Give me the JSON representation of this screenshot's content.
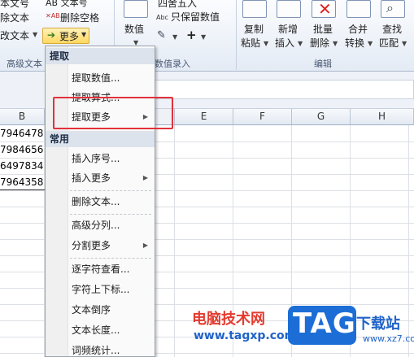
{
  "ribbon": {
    "left_items": [
      "本文号",
      "除文本",
      "改文本"
    ],
    "text_buttons": [
      "AB 文本号",
      "删除空格"
    ],
    "more_label": "更多",
    "group_label_left": "高级文本",
    "num_label": "数值",
    "num_items": [
      "四舍五入",
      "只保留数值"
    ],
    "num_group_label": "数值录入",
    "edit_buttons": [
      {
        "line1": "复制",
        "line2": "粘贴"
      },
      {
        "line1": "新增",
        "line2": "插入"
      },
      {
        "line1": "批量",
        "line2": "删除"
      },
      {
        "line1": "合并",
        "line2": "转换"
      },
      {
        "line1": "查找",
        "line2": "匹配"
      }
    ],
    "edit_group_label": "编辑"
  },
  "columns": [
    "B",
    "E",
    "F",
    "G",
    "H"
  ],
  "cells_b": [
    "7946478",
    "7984656",
    "6497834",
    "7964358"
  ],
  "menu": {
    "sections": [
      {
        "header": "提取",
        "items": [
          {
            "label": "提取数值...",
            "submenu": false
          },
          {
            "label": "提取算式...",
            "submenu": false
          },
          {
            "label": "提取更多",
            "submenu": true
          }
        ]
      },
      {
        "header": "常用",
        "items": [
          {
            "label": "插入序号...",
            "submenu": false
          },
          {
            "label": "插入更多",
            "submenu": true
          },
          {
            "label": "删除文本...",
            "submenu": false
          },
          {
            "label": "高级分列...",
            "submenu": false
          },
          {
            "label": "分割更多",
            "submenu": true
          },
          {
            "label": "逐字符查看...",
            "submenu": false
          },
          {
            "label": "字符上下标...",
            "submenu": false
          },
          {
            "label": "文本倒序",
            "submenu": false
          },
          {
            "label": "文本长度...",
            "submenu": false
          },
          {
            "label": "词频统计...",
            "submenu": false
          }
        ]
      }
    ]
  },
  "watermark": {
    "line1": "电脑技术网",
    "line2": "www.tagxp.com",
    "logo": "TAG",
    "site": "下载站",
    "site_url": "www.xz7.com"
  },
  "colors": {
    "highlight": "#e2323c",
    "more_button": "#ffd861",
    "logo_bg": "#1c6ed6"
  }
}
